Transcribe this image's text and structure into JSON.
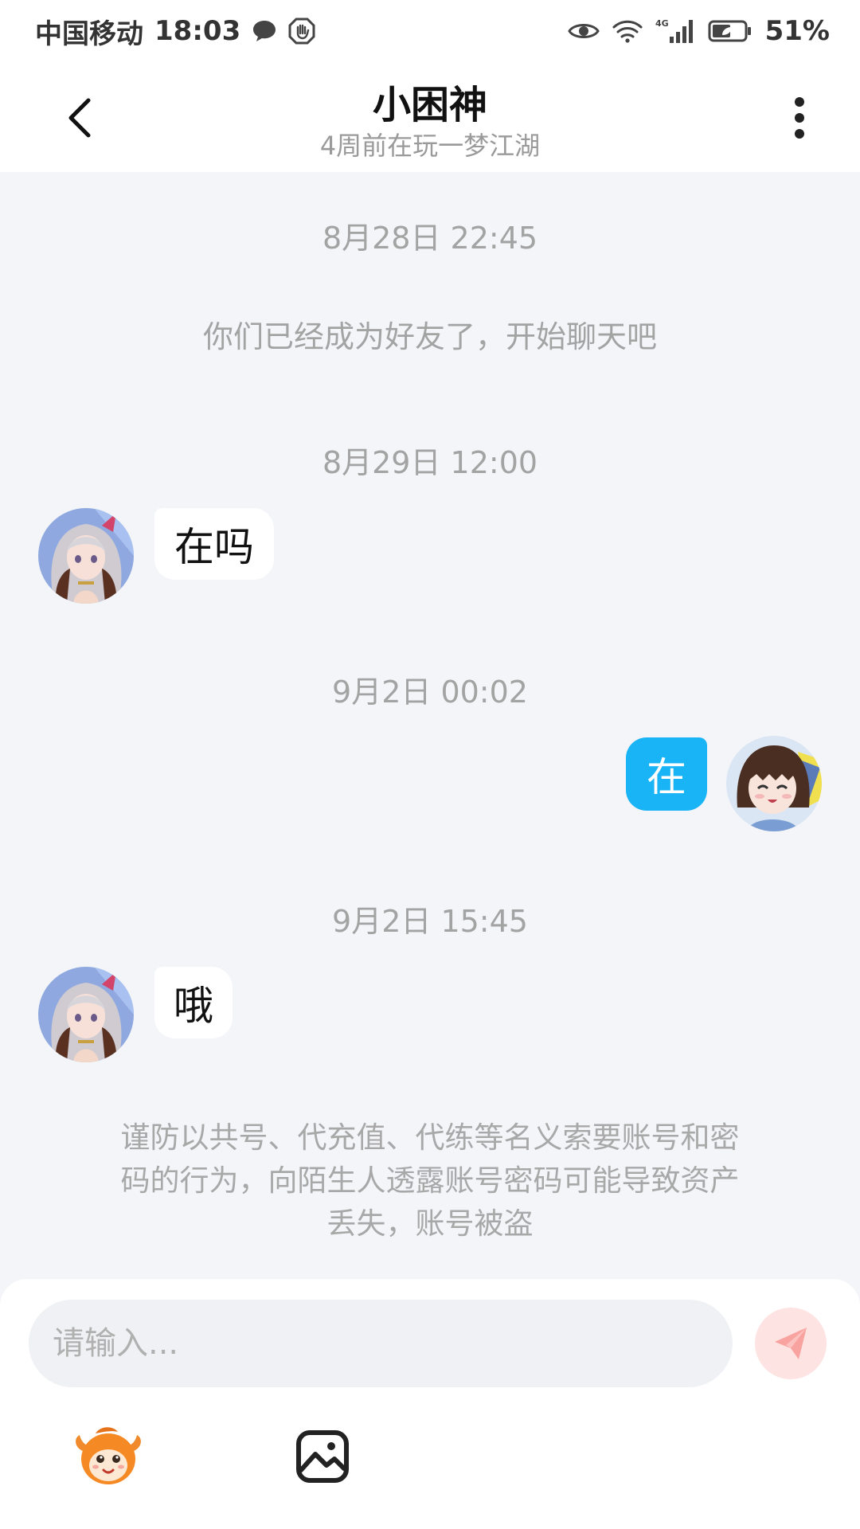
{
  "status_bar": {
    "carrier": "中国移动",
    "time": "18:03",
    "network": "4G",
    "battery": "51%"
  },
  "header": {
    "title": "小困神",
    "subtitle": "4周前在玩一梦江湖"
  },
  "messages": [
    {
      "kind": "timestamp",
      "text": "8月28日 22:45"
    },
    {
      "kind": "system",
      "text": "你们已经成为好友了，开始聊天吧"
    },
    {
      "kind": "timestamp",
      "text": "8月29日 12:00"
    },
    {
      "kind": "incoming",
      "text": "在吗"
    },
    {
      "kind": "timestamp",
      "text": "9月2日 00:02"
    },
    {
      "kind": "outgoing",
      "text": "在"
    },
    {
      "kind": "timestamp",
      "text": "9月2日 15:45"
    },
    {
      "kind": "incoming",
      "text": "哦"
    }
  ],
  "warning": {
    "line1": "谨防以共号、代充值、代练等名义索要账号和密",
    "line2": "码的行为，向陌生人透露账号密码可能导致资产",
    "line3": "丢失，账号被盗"
  },
  "composer": {
    "placeholder": "请输入..."
  },
  "colors": {
    "outgoing_bubble": "#19b4f6",
    "send_button": "#fde3e2",
    "chat_background": "#f3f5f9"
  },
  "icons": {
    "back": "chevron-left-icon",
    "more": "more-vertical-icon",
    "send": "paper-plane-icon",
    "emoji": "emoji-mascot-icon",
    "image": "image-icon"
  }
}
